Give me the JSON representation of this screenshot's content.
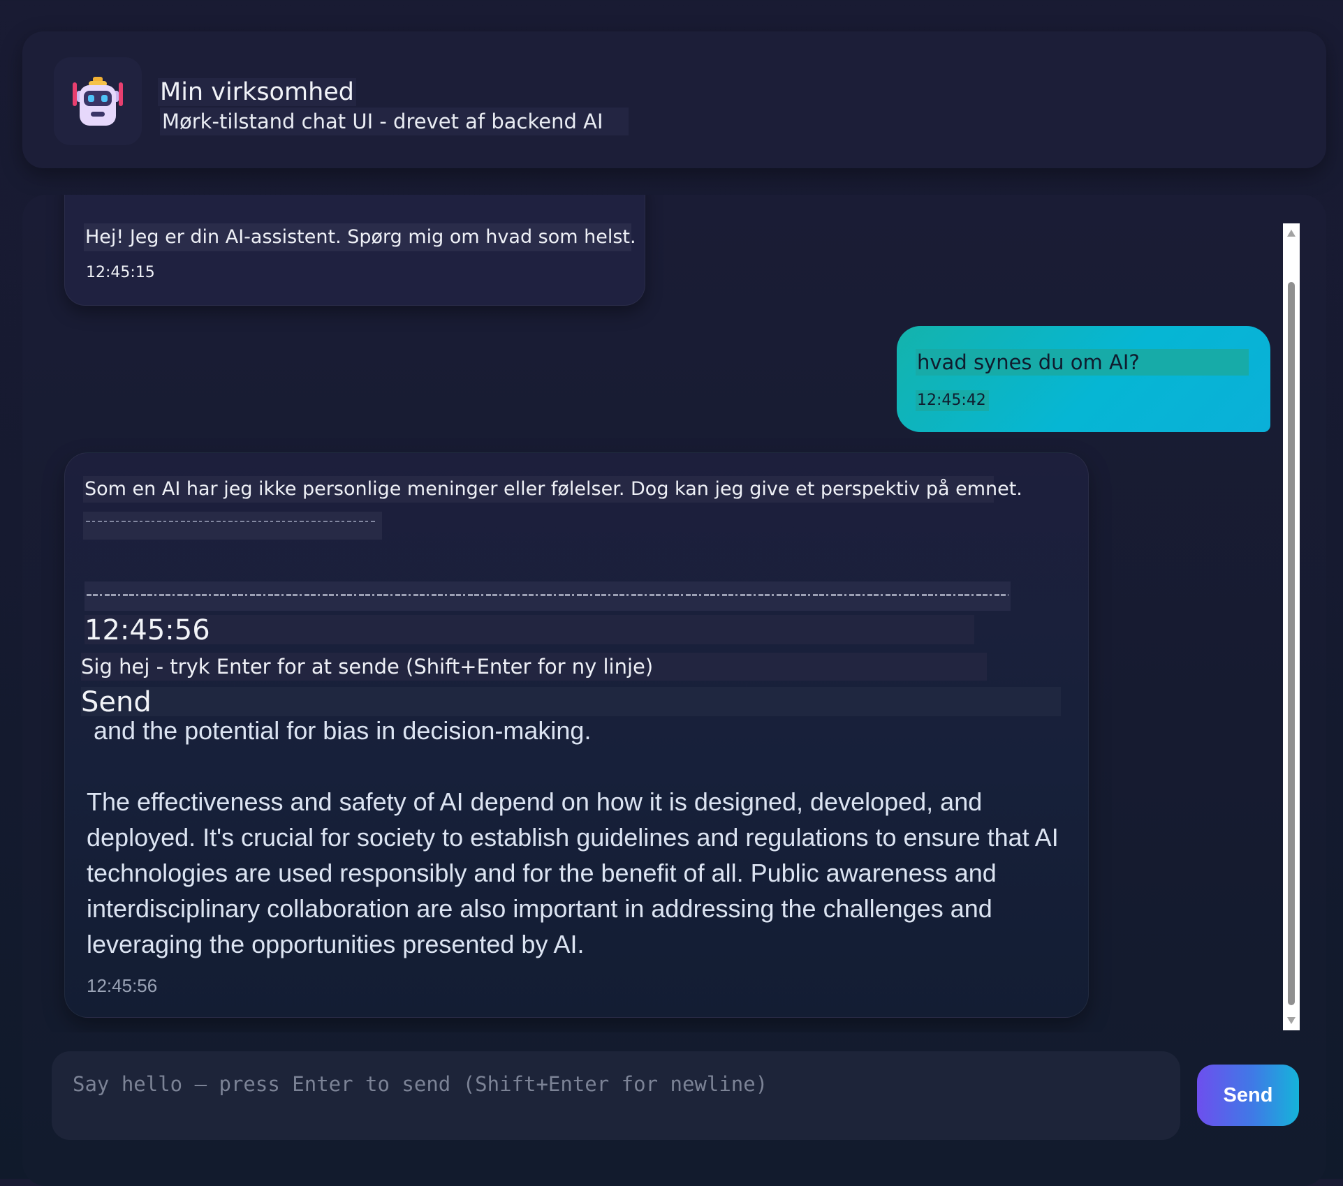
{
  "header": {
    "title": "Min virksomhed",
    "subtitle": "Mørk-tilstand chat UI - drevet af backend AI",
    "avatar_icon": "robot-icon"
  },
  "messages": [
    {
      "role": "assistant",
      "text": "Hej! Jeg er din AI-assistent. Spørg mig om hvad som helst.",
      "time": "12:45:15"
    },
    {
      "role": "user",
      "text": "hvad synes du om AI?",
      "time": "12:45:42"
    },
    {
      "role": "assistant",
      "intro": "Som en AI har jeg ikke personlige meninger eller følelser. Dog kan jeg give et perspektiv på emnet.",
      "overlay_time": "12:45:56",
      "overlay_placeholder": "Sig hej - tryk Enter for at sende (Shift+Enter for ny linje)",
      "overlay_send": "Send",
      "body": " and the potential for bias in decision-making.\n\nThe effectiveness and safety of AI depend on how it is designed, developed, and deployed. It's crucial for society to establish guidelines and regulations to ensure that AI technologies are used responsibly and for the benefit of all. Public awareness and interdisciplinary collaboration are also important in addressing the challenges and leveraging the opportunities presented by AI.",
      "time": "12:45:56"
    }
  ],
  "composer": {
    "placeholder": "Say hello — press Enter to send (Shift+Enter for newline)",
    "value": "",
    "send_label": "Send"
  },
  "colors": {
    "background": "#171a30",
    "user_bubble": "#06b6d4",
    "send_gradient_start": "#6d4fee",
    "send_gradient_end": "#15b4da"
  }
}
